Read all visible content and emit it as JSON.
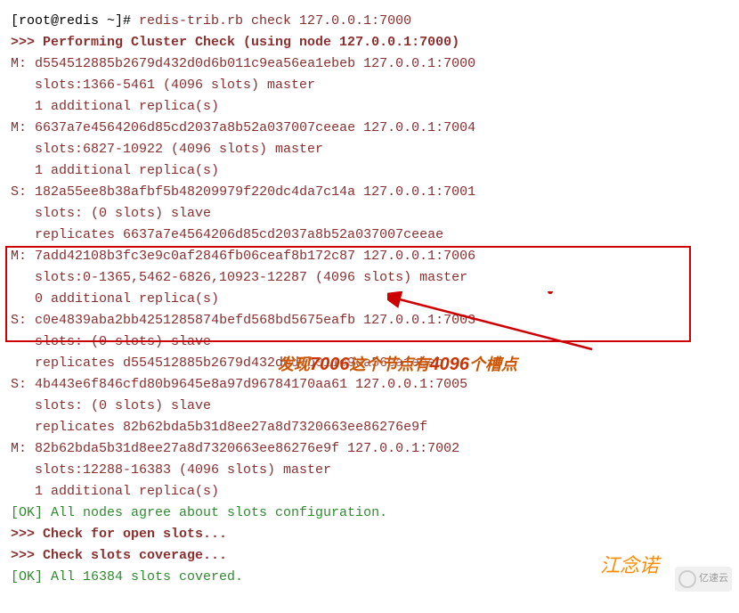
{
  "prompt": "[root@redis ~]# ",
  "command": "redis-trib.rb check 127.0.0.1:7000",
  "header": ">>> Performing Cluster Check (using node 127.0.0.1:7000)",
  "nodes": [
    {
      "role": "M:",
      "id": "d554512885b2679d432d0d6b011c9ea56ea1ebeb",
      "addr": "127.0.0.1:7000",
      "slots": "   slots:1366-5461 (4096 slots) master",
      "extra": "   1 additional replica(s)"
    },
    {
      "role": "M:",
      "id": "6637a7e4564206d85cd2037a8b52a037007ceeae",
      "addr": "127.0.0.1:7004",
      "slots": "   slots:6827-10922 (4096 slots) master",
      "extra": "   1 additional replica(s)"
    },
    {
      "role": "S:",
      "id": "182a55ee8b38afbf5b48209979f220dc4da7c14a",
      "addr": "127.0.0.1:7001",
      "slots": "   slots: (0 slots) slave",
      "extra": "   replicates 6637a7e4564206d85cd2037a8b52a037007ceeae"
    },
    {
      "role": "M:",
      "id": "7add42108b3fc3e9c0af2846fb06ceaf8b172c87",
      "addr": "127.0.0.1:7006",
      "slots": "   slots:0-1365,5462-6826,10923-12287 (4096 slots) master",
      "extra": "   0 additional replica(s)"
    },
    {
      "role": "S:",
      "id": "c0e4839aba2bb4251285874befd568bd5675eafb",
      "addr": "127.0.0.1:7003",
      "slots": "   slots: (0 slots) slave",
      "extra": "   replicates d554512885b2679d432d0d6b011c9ea56ea1ebeb"
    },
    {
      "role": "S:",
      "id": "4b443e6f846cfd80b9645e8a97d96784170aa61",
      "addr": "127.0.0.1:7005",
      "slots": "   slots: (0 slots) slave",
      "extra": "   replicates 82b62bda5b31d8ee27a8d7320663ee86276e9f"
    },
    {
      "role": "M:",
      "id": "82b62bda5b31d8ee27a8d7320663ee86276e9f",
      "addr": "127.0.0.1:7002",
      "slots": "   slots:12288-16383 (4096 slots) master",
      "extra": "   1 additional replica(s)"
    }
  ],
  "ok1": "[OK] All nodes agree about slots configuration.",
  "check1": ">>> Check for open slots...",
  "check2": ">>> Check slots coverage...",
  "ok2": "[OK] All 16384 slots covered.",
  "annotation": {
    "t1": "发现",
    "n1": "7006",
    "t2": "这个节点有",
    "n2": "4096",
    "t3": "个槽点"
  },
  "watermark1": "江念诺",
  "watermark2": "亿速云"
}
